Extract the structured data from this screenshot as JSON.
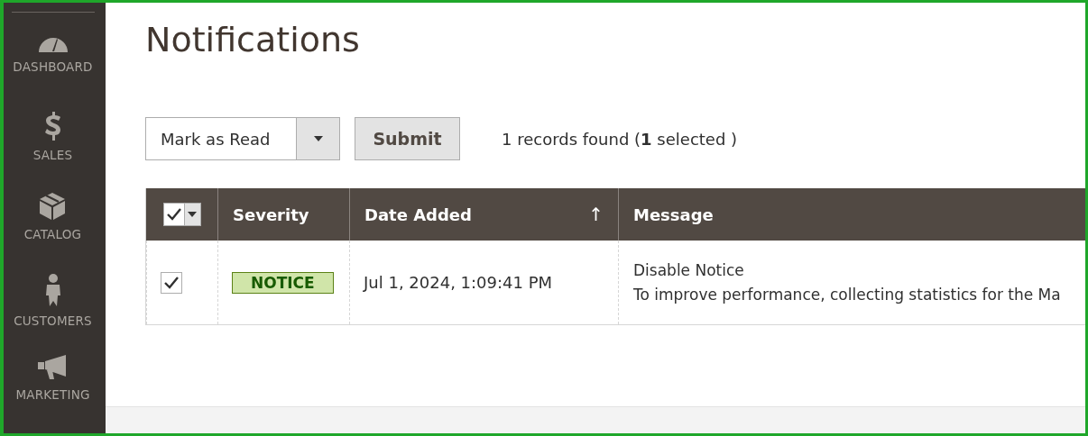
{
  "sidebar": {
    "items": [
      {
        "label": "DASHBOARD",
        "kind": "dashboard"
      },
      {
        "label": "SALES",
        "kind": "sales"
      },
      {
        "label": "CATALOG",
        "kind": "catalog"
      },
      {
        "label": "CUSTOMERS",
        "kind": "customers"
      },
      {
        "label": "MARKETING",
        "kind": "marketing"
      }
    ]
  },
  "page_title": "Notifications",
  "actions": {
    "select_value": "Mark as Read",
    "submit": "Submit",
    "records_found": "1 records found (**1** selected )"
  },
  "table": {
    "mass_select_checked": true,
    "columns": [
      {
        "label": "Severity"
      },
      {
        "label": "Date Added",
        "sort": "↑"
      },
      {
        "label": "Message"
      }
    ],
    "rows": [
      {
        "checked": true,
        "severity": "NOTICE",
        "date": "Jul 1, 2024, 1:09:41 PM",
        "title": "Disable Notice",
        "text": "To improve performance, collecting statistics for the Ma"
      }
    ]
  }
}
